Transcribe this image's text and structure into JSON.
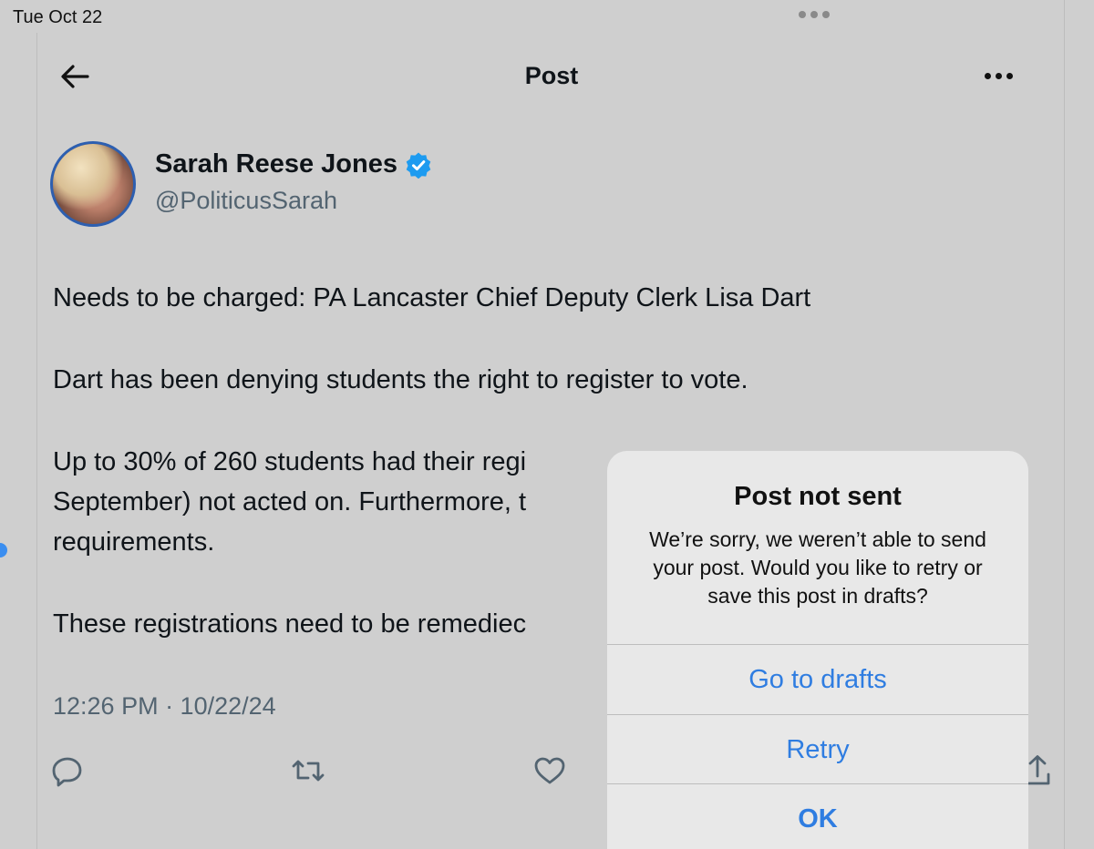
{
  "status_bar": {
    "date": "Tue Oct 22"
  },
  "header": {
    "title": "Post",
    "back_icon": "arrow-left-icon",
    "more_icon": "more-horizontal-icon"
  },
  "post": {
    "author": {
      "name": "Sarah Reese Jones",
      "handle": "@PoliticusSarah",
      "verified": true,
      "verified_color": "#1d9bf0"
    },
    "paragraphs": [
      "Needs to be charged: PA Lancaster Chief Deputy Clerk Lisa Dart",
      "Dart has been denying students the right to register to vote.",
      "Up to 30% of 260 students had their regi",
      "September) not acted on. Furthermore, t",
      "requirements.",
      "These registrations need to be remediec"
    ],
    "timestamp": "12:26 PM · 10/22/24",
    "actions": [
      "reply-icon",
      "repost-icon",
      "like-icon",
      "share-icon"
    ]
  },
  "alert": {
    "title": "Post not sent",
    "message": "We’re sorry, we weren’t able to send your post. Would you like to retry or save this post in drafts?",
    "buttons": {
      "drafts": "Go to drafts",
      "retry": "Retry",
      "ok": "OK"
    },
    "accent_color": "#2f7de1"
  }
}
